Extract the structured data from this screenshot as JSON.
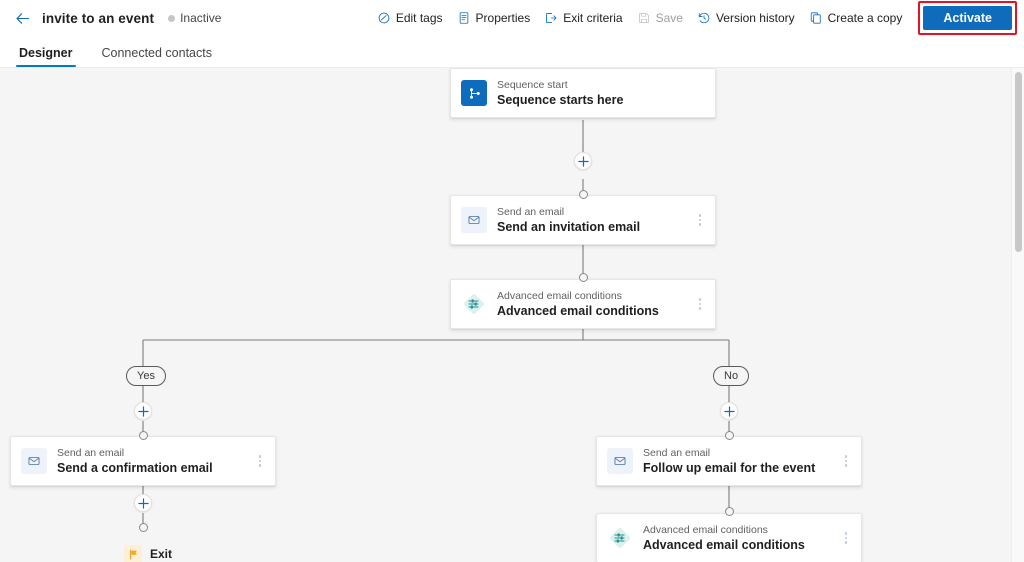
{
  "header": {
    "back_icon": "arrow-left-icon",
    "title": "invite to an event",
    "status": "Inactive",
    "commands": [
      {
        "label": "Edit tags",
        "icon": "tag-icon",
        "disabled": false
      },
      {
        "label": "Properties",
        "icon": "document-properties-icon",
        "disabled": false
      },
      {
        "label": "Exit criteria",
        "icon": "exit-icon",
        "disabled": false
      },
      {
        "label": "Save",
        "icon": "save-icon",
        "disabled": true
      },
      {
        "label": "Version history",
        "icon": "history-icon",
        "disabled": false
      },
      {
        "label": "Create a copy",
        "icon": "copy-icon",
        "disabled": false
      }
    ],
    "primary_action": "Activate",
    "primary_action_color": "#0f6cbd",
    "highlight_color": "#e81123"
  },
  "tabs": [
    {
      "label": "Designer",
      "active": true
    },
    {
      "label": "Connected contacts",
      "active": false
    }
  ],
  "canvas": {
    "background": "#f5f5f5",
    "nodes": {
      "start": {
        "type": "Sequence start",
        "name": "Sequence starts here",
        "icon": "sequence-start-icon"
      },
      "invitation_email": {
        "type": "Send an email",
        "name": "Send an invitation email",
        "icon": "mail-icon"
      },
      "conditions_main": {
        "type": "Advanced email conditions",
        "name": "Advanced email conditions",
        "icon": "conditions-icon"
      },
      "confirmation_email": {
        "type": "Send an email",
        "name": "Send a confirmation email",
        "icon": "mail-icon"
      },
      "follow_up_email": {
        "type": "Send an email",
        "name": "Follow up email for the event",
        "icon": "mail-icon"
      },
      "conditions_branch": {
        "type": "Advanced email conditions",
        "name": "Advanced email conditions",
        "icon": "conditions-icon"
      }
    },
    "branch_labels": {
      "yes": "Yes",
      "no": "No"
    },
    "exit": {
      "label": "Exit",
      "icon": "flag-icon"
    },
    "add_step_tooltip": "Add step"
  }
}
